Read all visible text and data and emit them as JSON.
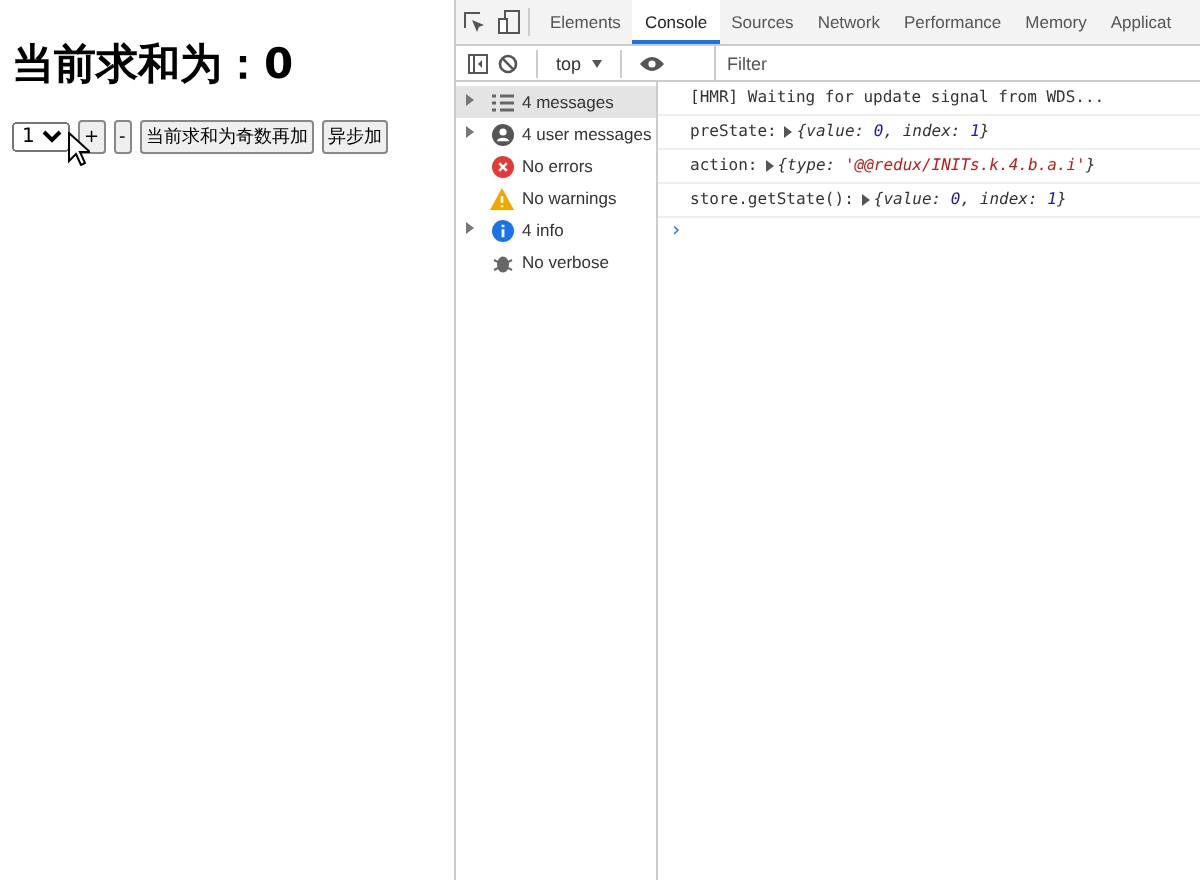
{
  "page": {
    "heading": "当前求和为：0",
    "select": {
      "value": "1"
    },
    "buttons": [
      "+",
      "-",
      "当前求和为奇数再加",
      "异步加"
    ]
  },
  "devtools": {
    "tabs": [
      {
        "label": "Elements",
        "selected": false
      },
      {
        "label": "Console",
        "selected": true
      },
      {
        "label": "Sources",
        "selected": false
      },
      {
        "label": "Network",
        "selected": false
      },
      {
        "label": "Performance",
        "selected": false
      },
      {
        "label": "Memory",
        "selected": false
      },
      {
        "label": "Applicat",
        "selected": false
      }
    ],
    "context": "top",
    "filter": {
      "placeholder": "Filter"
    },
    "sidebar": [
      {
        "kind": "list",
        "label": "4 messages",
        "expandable": true,
        "selected": true
      },
      {
        "kind": "user",
        "label": "4 user messages",
        "expandable": true,
        "selected": false
      },
      {
        "kind": "error",
        "label": "No errors",
        "expandable": false,
        "selected": false
      },
      {
        "kind": "warning",
        "label": "No warnings",
        "expandable": false,
        "selected": false
      },
      {
        "kind": "info",
        "label": "4 info",
        "expandable": true,
        "selected": false
      },
      {
        "kind": "verbose",
        "label": "No verbose",
        "expandable": false,
        "selected": false
      }
    ],
    "messages": [
      {
        "label": "[HMR] Waiting for update signal from WDS..."
      },
      {
        "label": "preState:",
        "object": [
          {
            "kind": "plain",
            "text": "{value: "
          },
          {
            "kind": "number",
            "text": "0"
          },
          {
            "kind": "plain",
            "text": ", index: "
          },
          {
            "kind": "number",
            "text": "1"
          },
          {
            "kind": "plain",
            "text": "}"
          }
        ]
      },
      {
        "label": "action:",
        "object": [
          {
            "kind": "plain",
            "text": "{type: "
          },
          {
            "kind": "string",
            "text": "'@@redux/INITs.k.4.b.a.i'"
          },
          {
            "kind": "plain",
            "text": "}"
          }
        ]
      },
      {
        "label": "store.getState():",
        "object": [
          {
            "kind": "plain",
            "text": "{value: "
          },
          {
            "kind": "number",
            "text": "0"
          },
          {
            "kind": "plain",
            "text": ", index: "
          },
          {
            "kind": "number",
            "text": "1"
          },
          {
            "kind": "plain",
            "text": "}"
          }
        ]
      }
    ],
    "prompt": "›"
  }
}
